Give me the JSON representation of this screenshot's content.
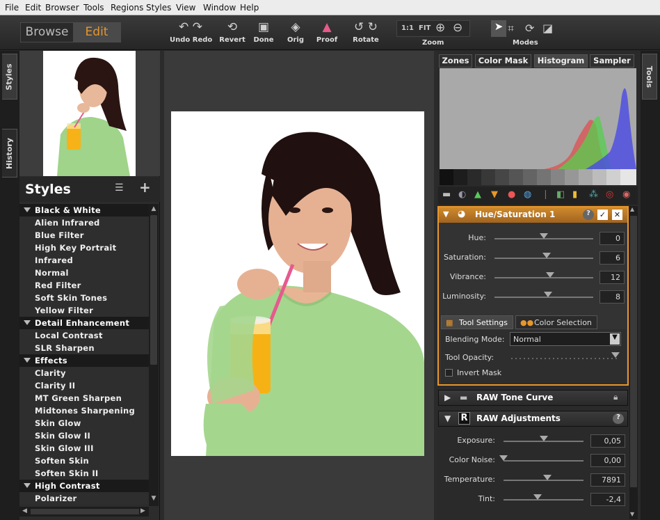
{
  "menu": [
    "File",
    "Edit",
    "Browser",
    "Tools",
    "Regions",
    "Styles",
    "View",
    "Window",
    "Help"
  ],
  "mode_tabs": {
    "browse": "Browse",
    "edit": "Edit"
  },
  "toolbar": {
    "undo_redo": "Undo Redo",
    "revert": "Revert",
    "done": "Done",
    "orig": "Orig",
    "proof": "Proof",
    "rotate": "Rotate",
    "zoom_1to1": "1:1",
    "zoom_fit": "FIT",
    "zoom_label": "Zoom",
    "modes_label": "Modes"
  },
  "left_tabs": {
    "styles": "Styles",
    "history": "History"
  },
  "right_tabs": {
    "tools": "Tools"
  },
  "styles_panel": {
    "title": "Styles",
    "categories": [
      {
        "name": "Black & White",
        "items": [
          "Alien Infrared",
          "Blue Filter",
          "High Key Portrait",
          "Infrared",
          "Normal",
          "Red Filter",
          "Soft Skin Tones",
          "Yellow Filter"
        ]
      },
      {
        "name": "Detail Enhancement",
        "items": [
          "Local Contrast",
          "SLR Sharpen"
        ]
      },
      {
        "name": "Effects",
        "items": [
          "Clarity",
          "Clarity II",
          "MT Green Sharpen",
          "Midtones Sharpening",
          "Skin Glow",
          "Skin Glow II",
          "Skin Glow III",
          "Soften Skin",
          "Soften Skin II"
        ]
      },
      {
        "name": "High Contrast",
        "items": [
          "Polarizer"
        ]
      }
    ]
  },
  "tool_tabs": [
    "Zones",
    "Color Mask",
    "Histogram",
    "Sampler"
  ],
  "hue_sat": {
    "title": "Hue/Saturation 1",
    "sliders": [
      {
        "label": "Hue:",
        "value": "0",
        "pos": 0.5
      },
      {
        "label": "Saturation:",
        "value": "6",
        "pos": 0.53
      },
      {
        "label": "Vibrance:",
        "value": "12",
        "pos": 0.56
      },
      {
        "label": "Luminosity:",
        "value": "8",
        "pos": 0.54
      }
    ],
    "sub_tabs": [
      "Tool Settings",
      "Color Selection"
    ],
    "blending_label": "Blending Mode:",
    "blending_value": "Normal",
    "opacity_label": "Tool Opacity:",
    "opacity_value": 1.0,
    "invert_mask": "Invert Mask"
  },
  "raw_tone_curve": {
    "title": "RAW Tone Curve"
  },
  "raw_adjustments": {
    "title": "RAW Adjustments",
    "sliders": [
      {
        "label": "Exposure:",
        "value": "0,05",
        "pos": 0.5
      },
      {
        "label": "Color Noise:",
        "value": "0,00",
        "pos": 0.0
      },
      {
        "label": "Temperature:",
        "value": "7891",
        "pos": 0.55
      },
      {
        "label": "Tint:",
        "value": "-2,4",
        "pos": 0.43
      }
    ]
  },
  "colors": {
    "accent": "#e8962b",
    "active_tab": "#e8962b"
  }
}
